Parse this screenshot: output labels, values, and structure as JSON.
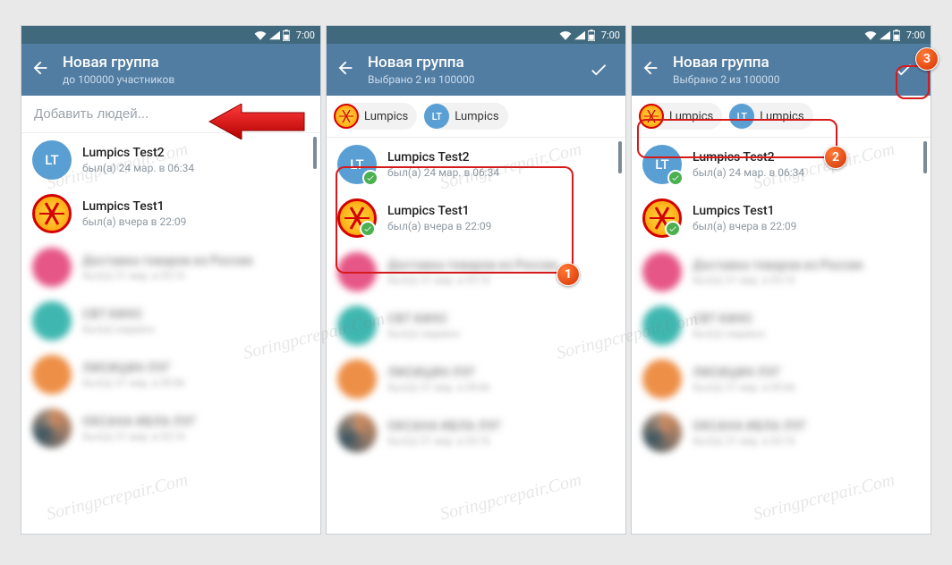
{
  "statusbar": {
    "time": "7:00"
  },
  "screen1": {
    "title": "Новая группа",
    "subtitle": "до 100000 участников",
    "search_placeholder": "Добавить людей..."
  },
  "screen2": {
    "title": "Новая группа",
    "subtitle": "Выбрано 2 из 100000",
    "chips": [
      {
        "label": "Lumpics"
      },
      {
        "label": "Lumpics",
        "initials": "LT"
      }
    ]
  },
  "screen3": {
    "title": "Новая группа",
    "subtitle": "Выбрано 2 из 100000",
    "chips": [
      {
        "label": "Lumpics"
      },
      {
        "label": "Lumpics",
        "initials": "LT"
      }
    ]
  },
  "contacts": [
    {
      "initials": "LT",
      "name": "Lumpics Test2",
      "status": "был(а) 24 мар. в 06:34",
      "avatar": "blue"
    },
    {
      "name": "Lumpics Test1",
      "status": "был(а) вчера в 22:09",
      "avatar": "orange"
    }
  ],
  "blurred": [
    {
      "avatar": "pink",
      "txt1": "Доставка товаров из России",
      "txt2": "был(а) 31 мар. в 03:16"
    },
    {
      "avatar": "teal",
      "txt1": "CBT КИНС",
      "txt2": "был(а) недавно"
    },
    {
      "avatar": "orange2",
      "txt1": "ЛИСИЦИН ЛУГ",
      "txt2": "был(а) 31 мар. в 09:06"
    },
    {
      "avatar": "mixed",
      "txt1": "ОКСАНА ИБЛА ЛУГ",
      "txt2": "был(а) 31 мар. в 03:16"
    }
  ],
  "annotations": {
    "n1": "1",
    "n2": "2",
    "n3": "3"
  },
  "watermark": "Soringpcrepair.Com"
}
